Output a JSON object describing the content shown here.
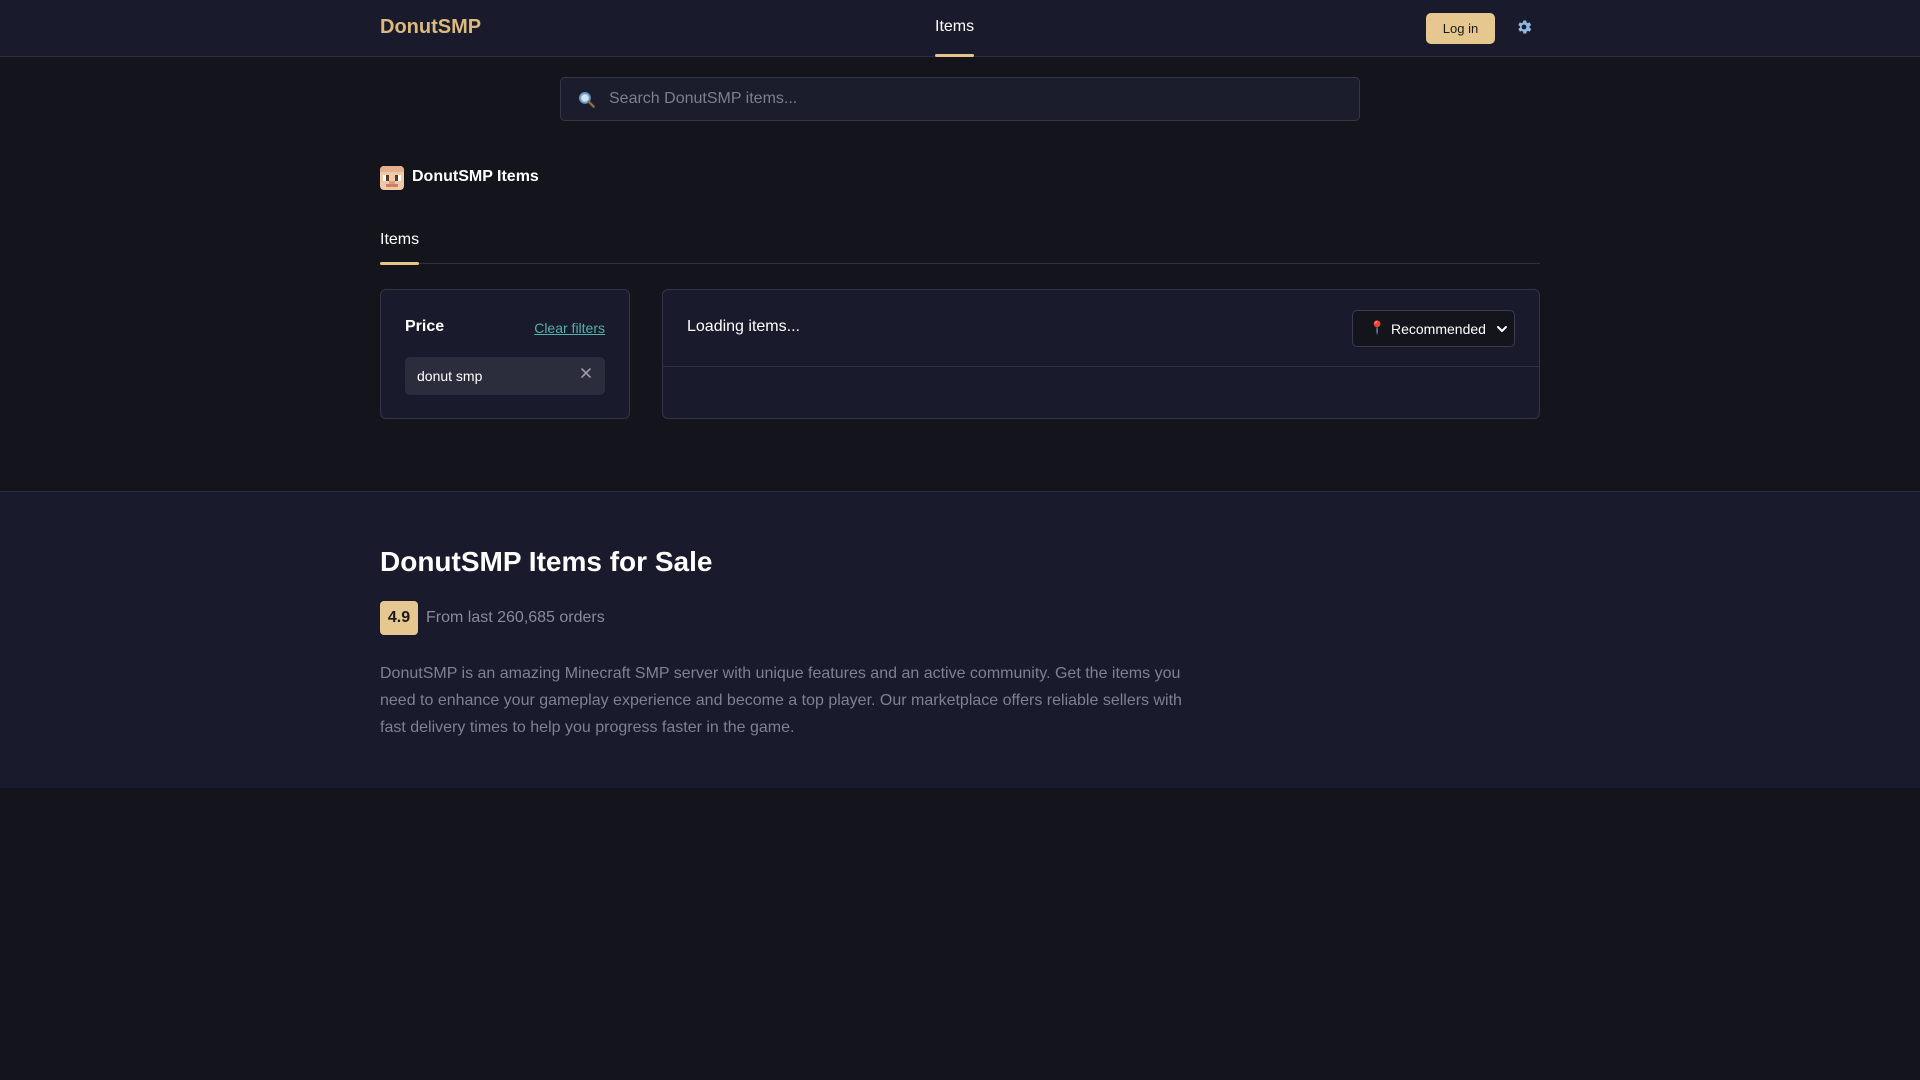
{
  "header": {
    "brand": "DonutSMP",
    "nav_tab": "Items",
    "login_label": "Log in"
  },
  "search": {
    "placeholder": "Search DonutSMP items..."
  },
  "page": {
    "title": "DonutSMP Items"
  },
  "tabs": {
    "active": "Items"
  },
  "filters": {
    "title": "Price",
    "clear_label": "Clear filters",
    "chip_label": "donut smp"
  },
  "results": {
    "status": "Loading items...",
    "sort": {
      "pin_glyph": "📍",
      "selected": "Recommended"
    }
  },
  "info": {
    "title": "DonutSMP Items for Sale",
    "rating": "4.9",
    "rating_caption": "From last 260,685 orders",
    "description": "DonutSMP is an amazing Minecraft SMP server with unique features and an active community. Get the items you need to enhance your gameplay experience and become a top player. Our marketplace offers reliable sellers with fast delivery times to help you progress faster in the game."
  },
  "colors": {
    "accent": "#e6c78f",
    "link": "#4fb3aa",
    "background": "#14141c",
    "panel": "#191a2c"
  },
  "icons": {
    "settings": "gear-icon",
    "search": "search-icon",
    "chip_close": "close-icon",
    "sort_dropdown": "chevron-down-icon",
    "page_avatar": "avatar"
  }
}
